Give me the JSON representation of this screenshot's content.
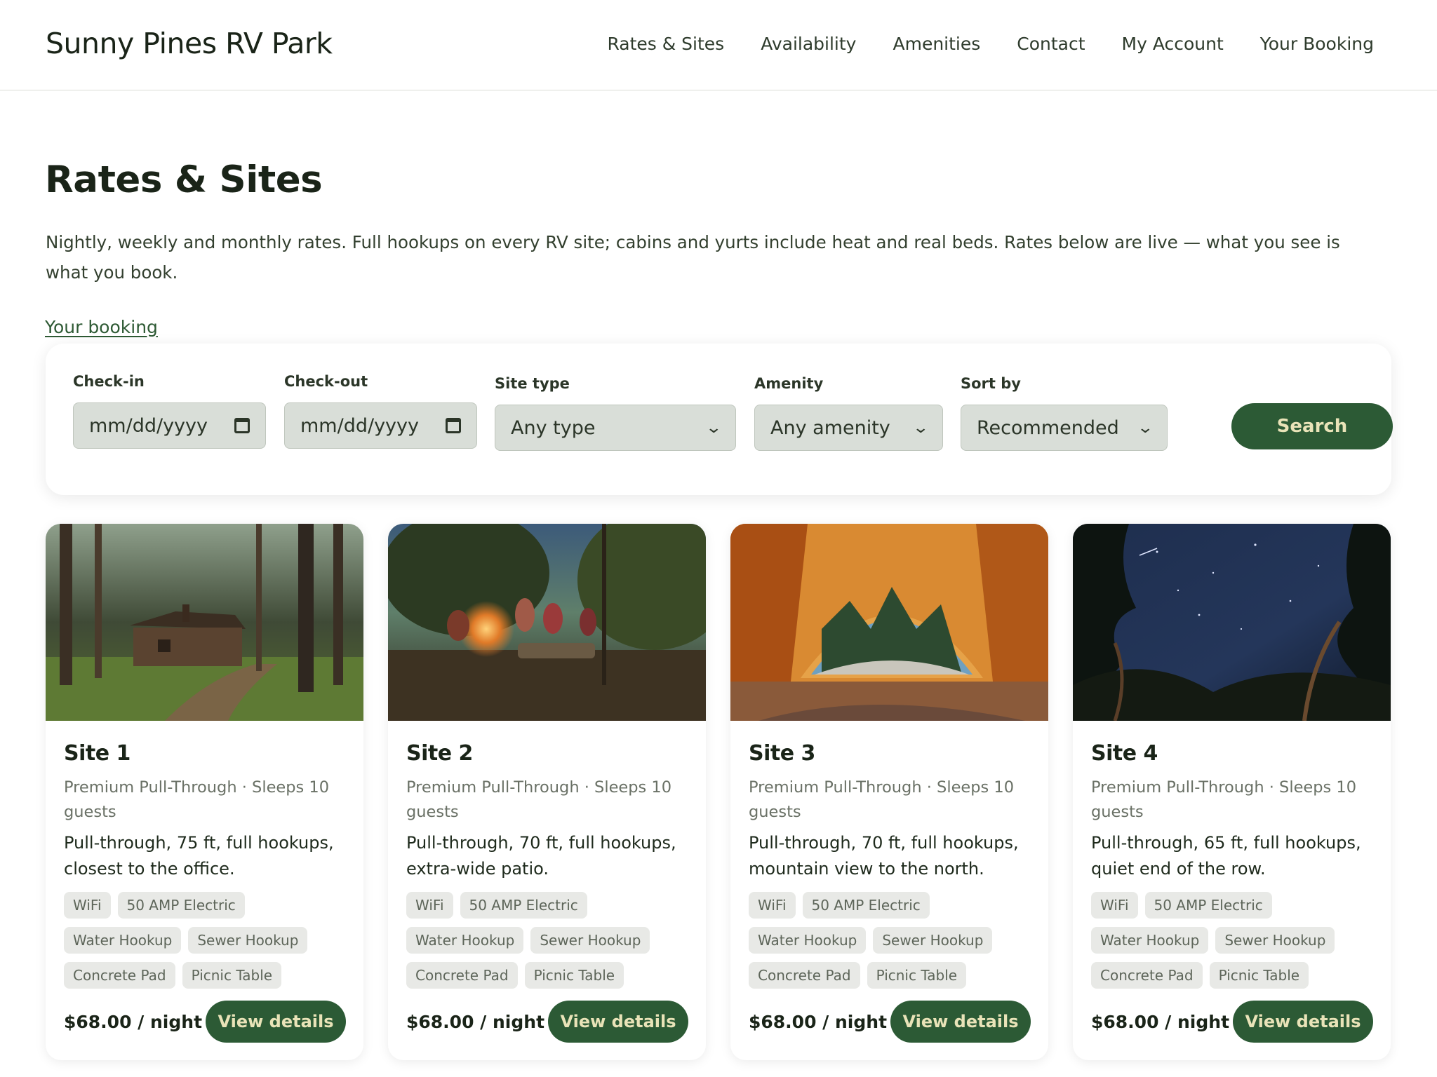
{
  "header": {
    "brand": "Sunny Pines RV Park",
    "nav": [
      "Rates & Sites",
      "Availability",
      "Amenities",
      "Contact",
      "My Account",
      "Your Booking"
    ]
  },
  "main": {
    "title": "Rates & Sites",
    "intro": "Nightly, weekly and monthly rates. Full hookups on every RV site; cabins and yurts include heat and real beds. Rates below are live — what you see is what you book.",
    "booking_link": "Your booking"
  },
  "search": {
    "checkin_label": "Check-in",
    "checkin_value": "mm/dd/yyyy",
    "checkout_label": "Check-out",
    "checkout_value": "mm/dd/yyyy",
    "site_type_label": "Site type",
    "site_type_value": "Any type",
    "amenity_label": "Amenity",
    "amenity_value": "Any amenity",
    "sort_label": "Sort by",
    "sort_value": "Recommended",
    "search_button": "Search"
  },
  "cards": [
    {
      "title": "Site 1",
      "subtitle": "Premium Pull-Through · Sleeps 10 guests",
      "description": "Pull-through, 75 ft, full hookups, closest to the office.",
      "tags": [
        "WiFi",
        "50 AMP Electric",
        "Water Hookup",
        "Sewer Hookup",
        "Concrete Pad",
        "Picnic Table"
      ],
      "price": "$68.00 / night",
      "button": "View details"
    },
    {
      "title": "Site 2",
      "subtitle": "Premium Pull-Through · Sleeps 10 guests",
      "description": "Pull-through, 70 ft, full hookups, extra-wide patio.",
      "tags": [
        "WiFi",
        "50 AMP Electric",
        "Water Hookup",
        "Sewer Hookup",
        "Concrete Pad",
        "Picnic Table"
      ],
      "price": "$68.00 / night",
      "button": "View details"
    },
    {
      "title": "Site 3",
      "subtitle": "Premium Pull-Through · Sleeps 10 guests",
      "description": "Pull-through, 70 ft, full hookups, mountain view to the north.",
      "tags": [
        "WiFi",
        "50 AMP Electric",
        "Water Hookup",
        "Sewer Hookup",
        "Concrete Pad",
        "Picnic Table"
      ],
      "price": "$68.00 / night",
      "button": "View details"
    },
    {
      "title": "Site 4",
      "subtitle": "Premium Pull-Through · Sleeps 10 guests",
      "description": "Pull-through, 65 ft, full hookups, quiet end of the row.",
      "tags": [
        "WiFi",
        "50 AMP Electric",
        "Water Hookup",
        "Sewer Hookup",
        "Concrete Pad",
        "Picnic Table"
      ],
      "price": "$68.00 / night",
      "button": "View details"
    }
  ],
  "colors": {
    "accent": "#2c5a35",
    "button_text": "#e9e3b8",
    "tag_bg": "#e8e9e6"
  }
}
